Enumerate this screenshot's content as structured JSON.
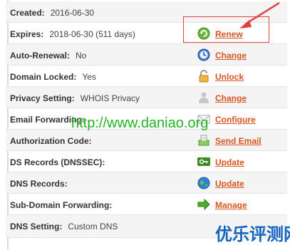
{
  "rows": [
    {
      "label": "Created:",
      "value": "2016-06-30",
      "action": "",
      "icon": ""
    },
    {
      "label": "Expires:",
      "value": "2018-06-30 (511 days)",
      "action": "Renew",
      "icon": "renew-icon"
    },
    {
      "label": "Auto-Renewal:",
      "value": "No",
      "action": "Change",
      "icon": "clock-icon"
    },
    {
      "label": "Domain Locked:",
      "value": "Yes",
      "action": "Unlock",
      "icon": "padlock-icon"
    },
    {
      "label": "Privacy Setting:",
      "value": "WHOIS Privacy",
      "action": "Change",
      "icon": "person-icon"
    },
    {
      "label": "Email Forwarding:",
      "value": "",
      "action": "Configure",
      "icon": "envelope-icon"
    },
    {
      "label": "Authorization Code:",
      "value": "",
      "action": "Send Email",
      "icon": "send-email-icon"
    },
    {
      "label": "DS Records (DNSSEC):",
      "value": "",
      "action": "Update",
      "icon": "key-icon"
    },
    {
      "label": "DNS Records:",
      "value": "",
      "action": "Update",
      "icon": "globe-icon"
    },
    {
      "label": "Sub-Domain Forwarding:",
      "value": "",
      "action": "Manage",
      "icon": "green-arrow-icon"
    },
    {
      "label": "DNS Setting:",
      "value": "Custom DNS",
      "action": "",
      "icon": ""
    }
  ],
  "watermarks": {
    "url": "http://www.daniao.org",
    "cn": "优乐评测网"
  },
  "colors": {
    "action_link": "#d9541e",
    "highlight": "#e14040",
    "watermark_url": "#22b322",
    "watermark_cn": "#1565c0"
  }
}
